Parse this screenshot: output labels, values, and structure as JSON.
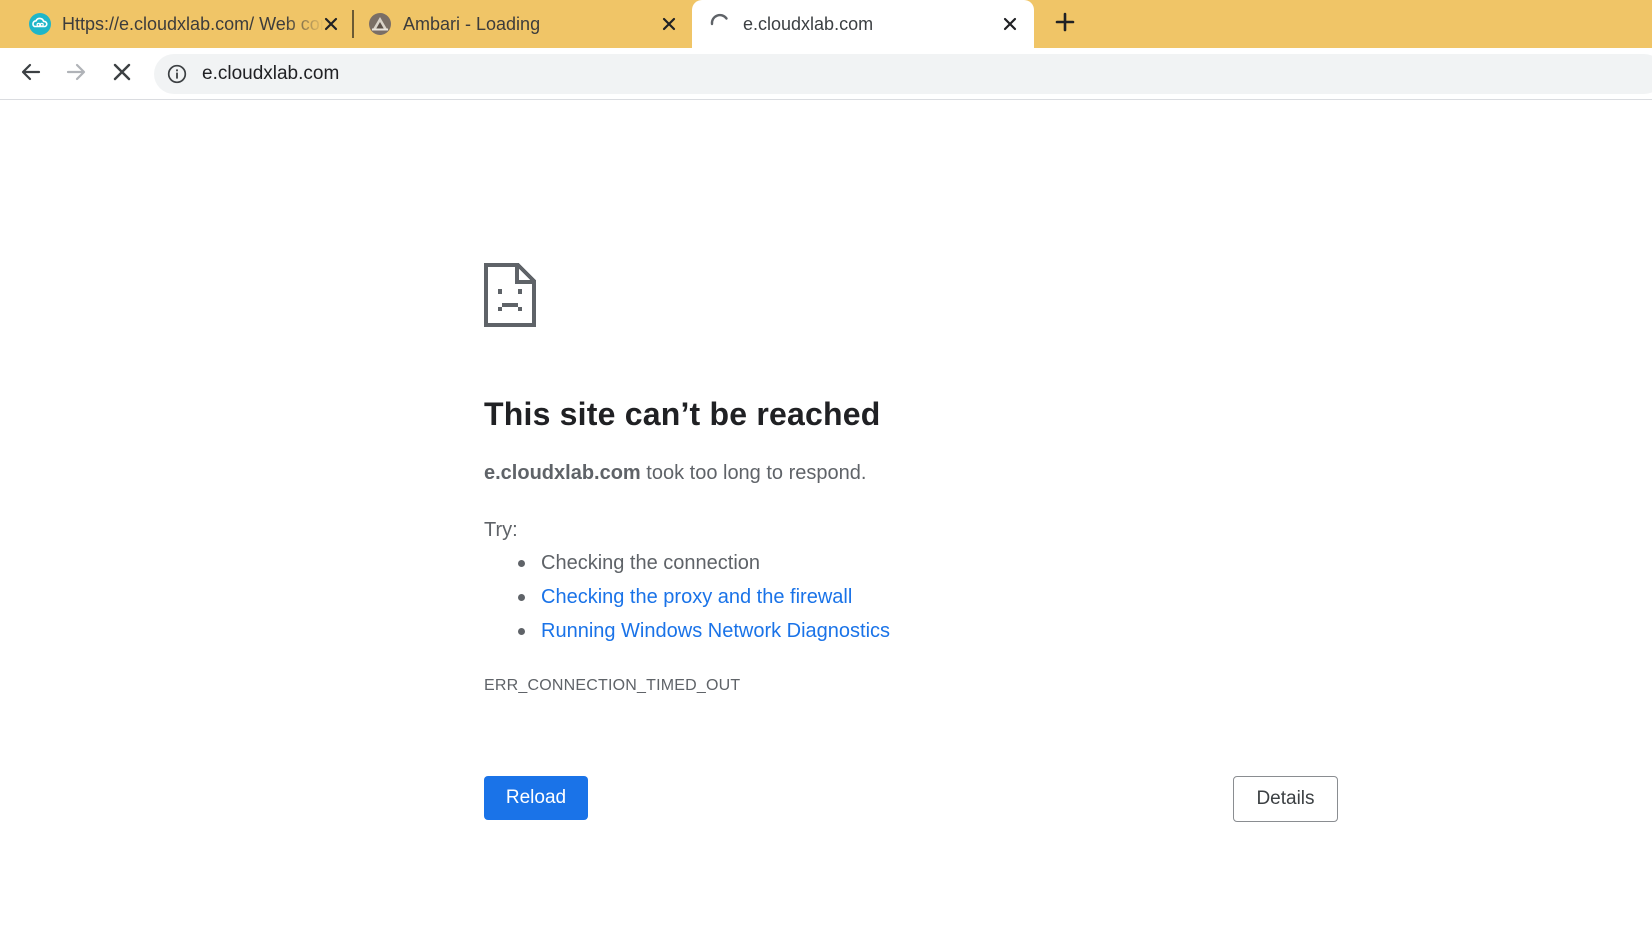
{
  "tabs": [
    {
      "title": "Https://e.cloudxlab.com/ Web console",
      "favicon": "cloudxlab-icon",
      "active": false
    },
    {
      "title": "Ambari - Loading",
      "favicon": "ambari-icon",
      "active": false
    },
    {
      "title": "e.cloudxlab.com",
      "favicon": "loading-spinner-icon",
      "active": true
    }
  ],
  "toolbar": {
    "back_icon": "back-arrow-icon",
    "forward_icon": "forward-arrow-icon",
    "stop_icon": "stop-icon",
    "new_tab_icon": "plus-icon"
  },
  "omnibox": {
    "url": "e.cloudxlab.com",
    "security_icon": "info-icon"
  },
  "error_page": {
    "icon": "sad-document-icon",
    "heading": "This site can’t be reached",
    "host": "e.cloudxlab.com",
    "summary_rest": " took too long to respond.",
    "try_label": "Try:",
    "suggestions": [
      {
        "text": "Checking the connection",
        "link": false
      },
      {
        "text": "Checking the proxy and the firewall",
        "link": true
      },
      {
        "text": "Running Windows Network Diagnostics",
        "link": true
      }
    ],
    "error_code": "ERR_CONNECTION_TIMED_OUT",
    "reload_label": "Reload",
    "details_label": "Details"
  },
  "colors": {
    "tab_strip": "#f0c567",
    "link": "#1a73e8",
    "primary_button": "#1a73e8",
    "text": "#5f6368",
    "heading": "#202124"
  }
}
